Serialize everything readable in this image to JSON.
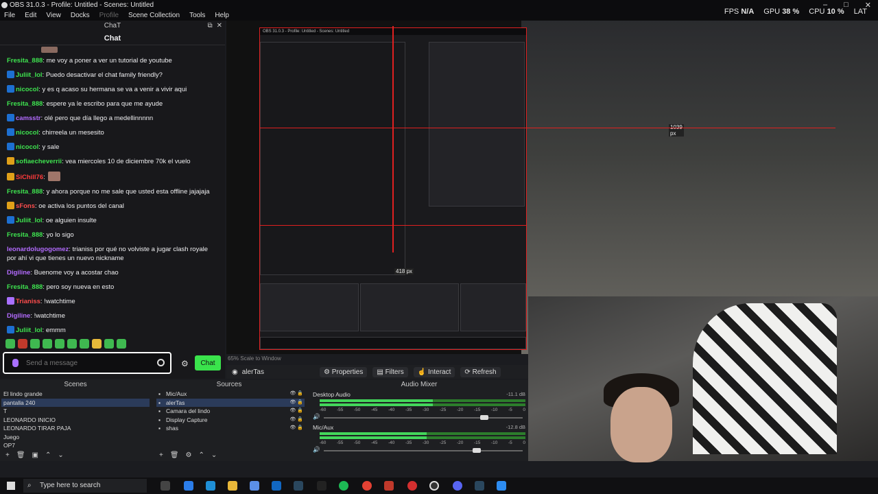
{
  "window": {
    "title": "OBS 31.0.3 - Profile: Untitled - Scenes: Untitled"
  },
  "menu": [
    {
      "label": "File"
    },
    {
      "label": "Edit"
    },
    {
      "label": "View"
    },
    {
      "label": "Docks"
    },
    {
      "label": "Profile"
    },
    {
      "label": "Scene Collection"
    },
    {
      "label": "Tools"
    },
    {
      "label": "Help"
    }
  ],
  "stats": {
    "fps_label": "FPS",
    "fps_value": "N/A",
    "gpu_label": "GPU",
    "gpu_value": "38 %",
    "cpu_label": "CPU",
    "cpu_value": "10 %",
    "lat_label": "LAT"
  },
  "chat_dock": {
    "dock_title": "ChaT",
    "header": "Chat"
  },
  "messages": [
    {
      "user": "Fresita_888",
      "text": ": me voy a poner a ver un tutorial de youtube",
      "color": "#3ee34f",
      "badge": ""
    },
    {
      "user": "Juliit_lol",
      "text": ": Puedo desactivar el chat family friendly?",
      "color": "#3ee34f",
      "badge": "blue"
    },
    {
      "user": "nicocol",
      "text": ": y es q acaso su hermana se va a venir a vivir aqui",
      "color": "#3ee34f",
      "badge": "blue"
    },
    {
      "user": "Fresita_888",
      "text": ": espere ya le escribo para que me ayude",
      "color": "#3ee34f",
      "badge": ""
    },
    {
      "user": "camsstr",
      "text": ": olé pero que día llego a medellinnnnn",
      "color": "#b36bff",
      "badge": "blue"
    },
    {
      "user": "nicocol",
      "text": ": chirreela un mesesito",
      "color": "#3ee34f",
      "badge": "blue"
    },
    {
      "user": "nicocol",
      "text": ": y sale",
      "color": "#3ee34f",
      "badge": "blue"
    },
    {
      "user": "sofiaecheverrii",
      "text": ": vea miercoles 10 de diciembre 70k el vuelo",
      "color": "#3ee34f",
      "badge": "gold"
    },
    {
      "user": "SiChill76",
      "text": ":",
      "color": "#ff3b3b",
      "badge": "gold",
      "emote": true
    },
    {
      "user": "Fresita_888",
      "text": ": y ahora porque no me sale que usted esta offline jajajaja",
      "color": "#3ee34f",
      "badge": ""
    },
    {
      "user": "sFons",
      "text": ": oe activa los puntos del canal",
      "color": "#ff4d4d",
      "badge": "gold"
    },
    {
      "user": "Juliit_lol",
      "text": ": oe alguien insulte",
      "color": "#3ee34f",
      "badge": "blue"
    },
    {
      "user": "Fresita_888",
      "text": ": yo lo sigo",
      "color": "#3ee34f",
      "badge": ""
    },
    {
      "user": "leonardolugogomez",
      "text": ": trianiss por qué no volviste a jugar clash royale por ahí vi que tienes un nuevo nickname",
      "color": "#b36bff",
      "badge": ""
    },
    {
      "user": "Digiline",
      "text": ": Buenome voy a acostar chao",
      "color": "#b36bff",
      "badge": ""
    },
    {
      "user": "Fresita_888",
      "text": ": pero soy nueva en esto",
      "color": "#3ee34f",
      "badge": ""
    },
    {
      "user": "Trianiss",
      "text": ": !watchtime",
      "color": "#ff4d4d",
      "badge": "mic"
    },
    {
      "user": "Digiline",
      "text": ": !watchtime",
      "color": "#b36bff",
      "badge": ""
    },
    {
      "user": "Juliit_lol",
      "text": ": emmm",
      "color": "#3ee34f",
      "badge": "blue"
    }
  ],
  "chat_input": {
    "placeholder": "Send a message",
    "send_label": "Chat"
  },
  "preview": {
    "nested_title": "OBS 31.0.3 - Profile: Untitled - Scenes: Untitled",
    "measure_1": "418 px",
    "measure_2": "1039 px"
  },
  "toolbar": {
    "scale_text": "65% Scale to Window",
    "source_name": "alerTas",
    "properties": "Properties",
    "filters": "Filters",
    "interact": "Interact",
    "refresh": "Refresh"
  },
  "scenes": {
    "title": "Scenes",
    "items": [
      "El lindo grande",
      "pantalla 240",
      "T",
      "LEONARDO INICIO",
      "LEONARDO TIRAR PAJA",
      "Juego",
      "OP7"
    ],
    "selected": 1
  },
  "sources": {
    "title": "Sources",
    "items": [
      "Mic/Aux",
      "alerTas",
      "Camara del lindo",
      "Display Capture",
      "shas"
    ],
    "selected": 1
  },
  "mixer": {
    "title": "Audio Mixer",
    "channels": [
      {
        "name": "Desktop Audio",
        "db": "-11.1 dB",
        "level": 0.55,
        "fader": 0.82
      },
      {
        "name": "Mic/Aux",
        "db": "-12.8 dB",
        "level": 0.52,
        "fader": 0.78
      }
    ],
    "scale": [
      "-60",
      "-55",
      "-50",
      "-45",
      "-40",
      "-35",
      "-30",
      "-25",
      "-20",
      "-15",
      "-10",
      "-5",
      "0"
    ]
  },
  "taskbar": {
    "search_placeholder": "Type here to search"
  },
  "colors": {
    "accent_green": "#3ae34c",
    "twitch_purple": "#a970ff",
    "selection_red": "#e02020"
  }
}
